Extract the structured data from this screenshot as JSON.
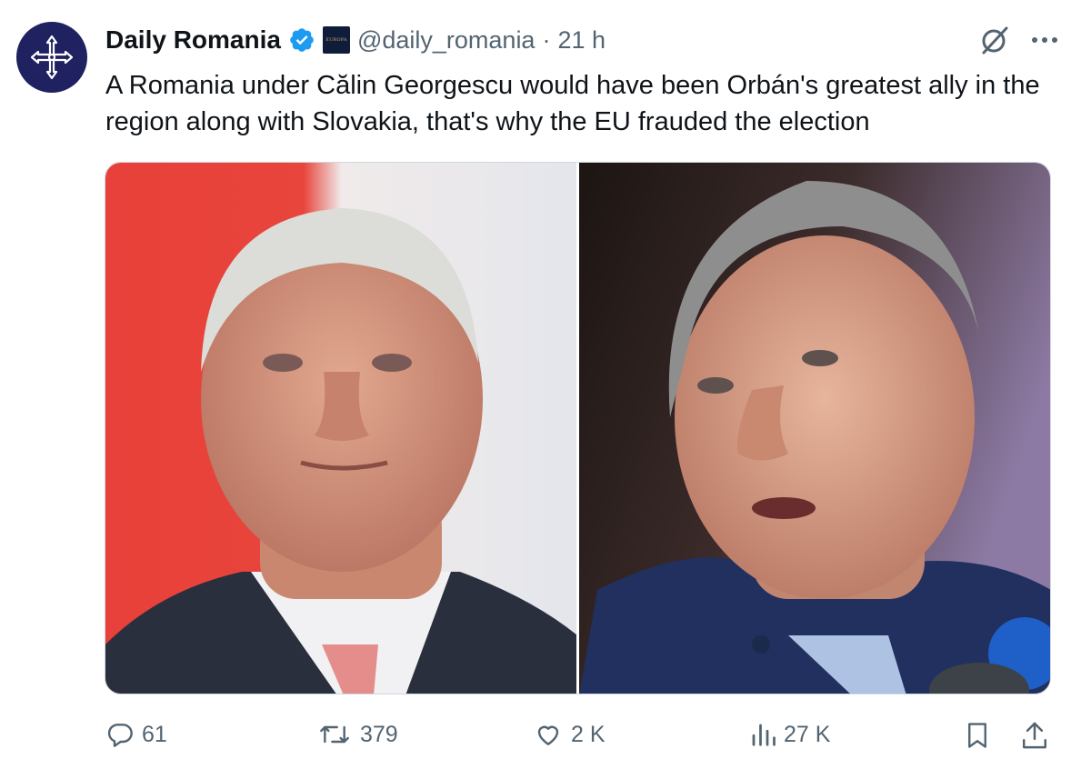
{
  "tweet": {
    "author_name": "Daily Romania",
    "handle": "@daily_romania",
    "separator": "·",
    "time": "21 h",
    "affiliate_badge_text": "EUROPA",
    "text": "A Romania under Călin Georgescu would have been Orbán's greatest ally in the region along with Slovakia, that's why the EU frauded the election"
  },
  "actions": {
    "replies": "61",
    "reposts": "379",
    "likes": "2 K",
    "views": "27 K"
  },
  "colors": {
    "verified_blue": "#1d9bf0",
    "muted_text": "#536471",
    "avatar_bg": "#1f2160"
  },
  "icons": {
    "avatar": "romanian-cross-icon",
    "verified": "verified-badge-icon",
    "grok": "grok-icon",
    "more": "more-icon",
    "reply": "reply-icon",
    "repost": "repost-icon",
    "like": "like-icon",
    "views": "views-icon",
    "bookmark": "bookmark-icon",
    "share": "share-icon"
  }
}
